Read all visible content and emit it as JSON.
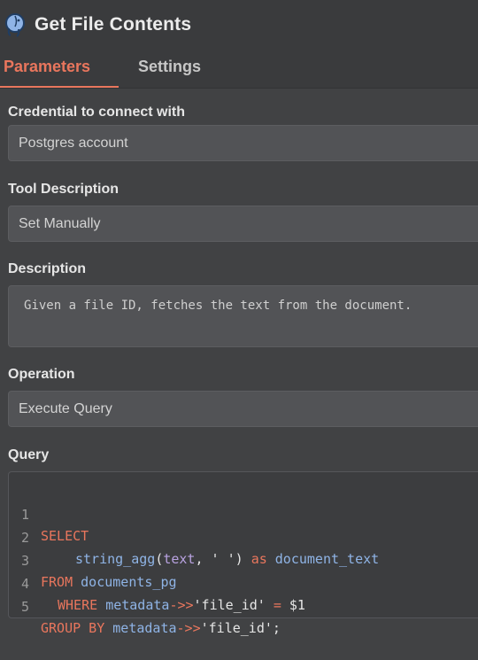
{
  "header": {
    "title": "Get File Contents",
    "icon": "postgres-elephant-icon"
  },
  "tabs": [
    {
      "label": "Parameters",
      "active": true
    },
    {
      "label": "Settings",
      "active": false
    }
  ],
  "colors": {
    "accent": "#e9765d",
    "background": "#414244",
    "field": "#525356"
  },
  "fields": {
    "credential": {
      "label": "Credential to connect with",
      "value": "Postgres account"
    },
    "tool_description": {
      "label": "Tool Description",
      "value": "Set Manually"
    },
    "description": {
      "label": "Description",
      "value": "Given a file ID, fetches the text from the document."
    },
    "operation": {
      "label": "Operation",
      "value": "Execute Query"
    },
    "query": {
      "label": "Query",
      "line_numbers": [
        "1",
        "2",
        "3",
        "4",
        "5"
      ],
      "tokens": {
        "l1_select": "SELECT",
        "l2_fn": "string_agg",
        "l2_open": "(",
        "l2_col": "text",
        "l2_sep": ", ' ') ",
        "l2_as": "as",
        "l2_alias": "document_text",
        "l3_from": "FROM",
        "l3_table": "documents_pg",
        "l4_where": "WHERE",
        "l4_col": "metadata",
        "l4_op": "->>",
        "l4_key": "'file_id'",
        "l4_eq": " = ",
        "l4_param": "$1",
        "l5_group": "GROUP BY",
        "l5_col": "metadata",
        "l5_op": "->>",
        "l5_key": "'file_id'",
        "l5_end": ";"
      }
    }
  }
}
